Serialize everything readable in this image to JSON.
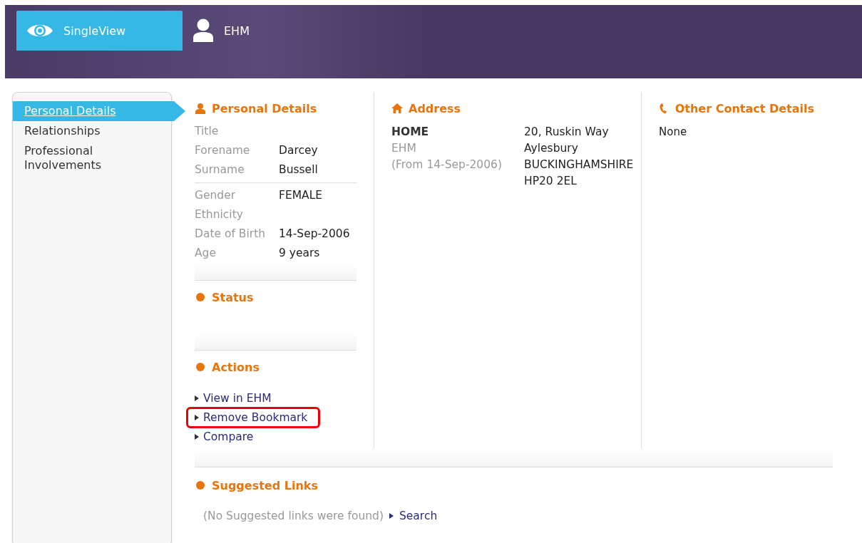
{
  "nav_tabs": [
    {
      "label": "SingleView",
      "selected": true
    },
    {
      "label": "EHM",
      "selected": false
    }
  ],
  "sidebar": {
    "items": [
      {
        "label": "Personal Details",
        "selected": true
      },
      {
        "label": "Relationships",
        "selected": false
      },
      {
        "label": "Professional Involvements",
        "selected": false
      }
    ]
  },
  "personal_details": {
    "title": "Personal Details",
    "groups": [
      {
        "fields": [
          {
            "label": "Title"
          },
          {
            "label": "Forename",
            "value": "Darcey"
          },
          {
            "label": "Surname",
            "value": "Bussell"
          }
        ]
      },
      {
        "fields": [
          {
            "label": "Gender",
            "value": "FEMALE"
          },
          {
            "label": "Ethnicity"
          },
          {
            "label": "Date of Birth",
            "value": "14-Sep-2006"
          },
          {
            "label": "Age",
            "value": "9 years"
          }
        ]
      }
    ]
  },
  "status": {
    "title": "Status"
  },
  "actions": {
    "title": "Actions",
    "items": [
      {
        "label": "View in EHM",
        "highlighted": false
      },
      {
        "label": "Remove Bookmark",
        "highlighted": true
      },
      {
        "label": "Compare",
        "highlighted": false
      }
    ]
  },
  "address": {
    "title": "Address",
    "entries": [
      {
        "type": "HOME",
        "source": "EHM",
        "from": "(From 14-Sep-2006)",
        "lines": [
          "20, Ruskin Way",
          "Aylesbury",
          "BUCKINGHAMSHIRE",
          "HP20 2EL"
        ]
      }
    ]
  },
  "other_contact": {
    "title": "Other Contact Details",
    "text": "None"
  },
  "suggested_links": {
    "title": "Suggested Links",
    "message": "(No Suggested links were found)",
    "link": "Search"
  }
}
